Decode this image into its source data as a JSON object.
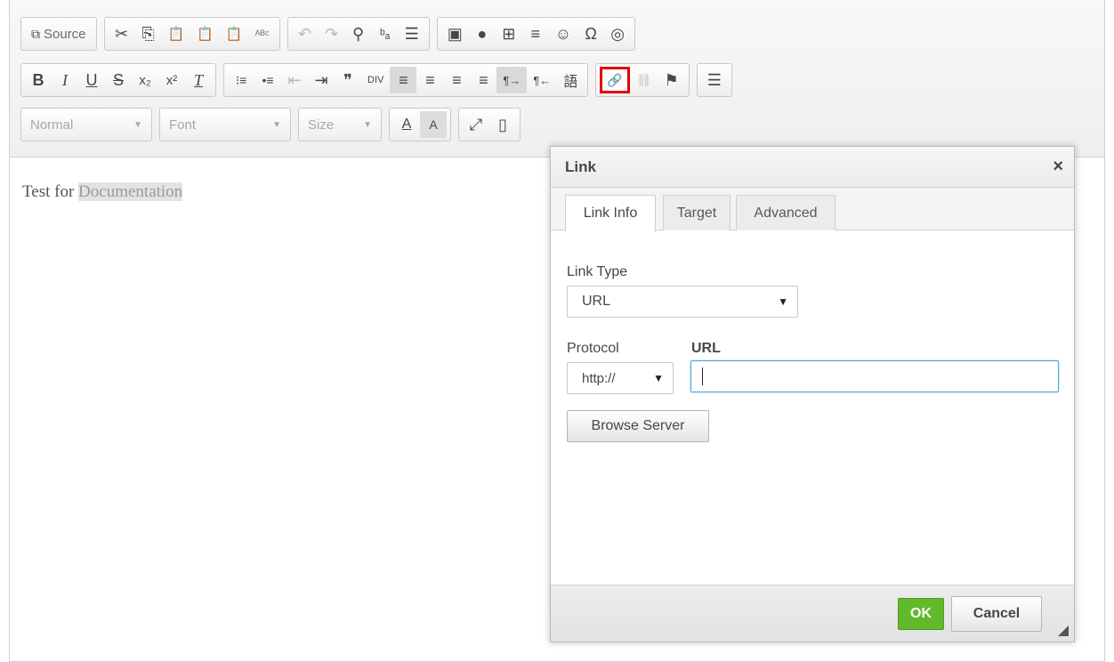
{
  "toolbar": {
    "source_label": "Source",
    "format_combo": "Normal",
    "font_combo": "Font",
    "size_combo": "Size",
    "glyphs": {
      "source": "⧉",
      "cut": "✂",
      "copy": "⎘",
      "paste": "📋",
      "paste_text": "📋",
      "paste_word": "📋",
      "spellcheck": "ᴬᴮᶜ",
      "undo": "↶",
      "redo": "↷",
      "find": "⚲",
      "replace": "ᵇₐ",
      "select_all": "☰",
      "image": "▣",
      "flash": "●",
      "table": "⊞",
      "hline": "≡",
      "smiley": "☺",
      "special_char": "Ω",
      "iframe": "◎",
      "bold": "B",
      "italic": "I",
      "underline": "U",
      "strike": "S",
      "subscript": "x₂",
      "superscript": "x²",
      "remove_format": "T",
      "numbered_list": "⁝≡",
      "bulleted_list": "•≡",
      "outdent": "⇤",
      "indent": "⇥",
      "blockquote": "❞",
      "div": "DIV",
      "align_left": "≡",
      "align_center": "≡",
      "align_right": "≡",
      "justify": "≡",
      "ltr": "¶→",
      "rtl": "¶←",
      "language": "語",
      "link": "🔗",
      "unlink": "⛓",
      "anchor": "⚑",
      "templates": "☰",
      "text_color": "A",
      "bg_color": "A",
      "maximize": "⤢",
      "show_blocks": "▯"
    }
  },
  "content": {
    "text_plain": "Test for ",
    "text_selected": "Documentation"
  },
  "dialog": {
    "title": "Link",
    "close": "×",
    "tabs": [
      "Link Info",
      "Target",
      "Advanced"
    ],
    "link_type_label": "Link Type",
    "link_type_value": "URL",
    "protocol_label": "Protocol",
    "protocol_value": "http://",
    "url_label": "URL",
    "url_value": "",
    "browse_label": "Browse Server",
    "ok_label": "OK",
    "cancel_label": "Cancel",
    "dropdown_arrow": "▼"
  },
  "colors": {
    "highlight": "#e20000",
    "ok_green": "#61b92b",
    "focus_blue": "#4aa3d9"
  }
}
